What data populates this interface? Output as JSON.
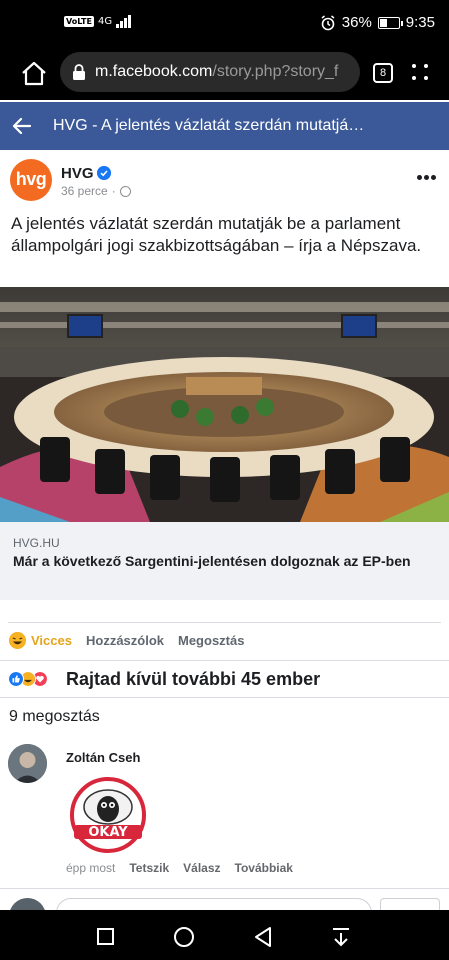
{
  "status_bar": {
    "volte": "VoLTE",
    "network": "4G",
    "battery_percent_text": "36%",
    "battery_level": 0.36,
    "time": "9:35"
  },
  "browser": {
    "url_domain": "m.facebook.com",
    "url_path": "/story.php?story_f",
    "tab_count": "8"
  },
  "fb_header": {
    "title": "HVG - A jelentés vázlatát szerdán mutatjá…"
  },
  "post": {
    "avatar_text": "hvg",
    "page_name": "HVG",
    "time": "36 perce",
    "separator": "·",
    "text": "A jelentés vázlatát szerdán mutatják be a parlament állampolgári jogi szakbizottságában – írja a Népszava."
  },
  "link": {
    "domain": "HVG.HU",
    "title": "Már a következő Sargentini-jelentésen dolgoznak az EP-ben"
  },
  "actions": {
    "reaction_label": "Vicces",
    "comment_label": "Hozzászólok",
    "share_label": "Megosztás"
  },
  "reactions": {
    "summary": "Rajtad kívül további 45 ember"
  },
  "shares": "9 megosztás",
  "comment": {
    "author": "Zoltán Cseh",
    "sticker_text": "OKAY",
    "time": "épp most",
    "like": "Tetszik",
    "reply": "Válasz",
    "more": "Továbbiak"
  },
  "colors": {
    "fb_blue": "#3b5998",
    "hvg_orange": "#f26b21",
    "haha_yellow": "#f7b125"
  }
}
